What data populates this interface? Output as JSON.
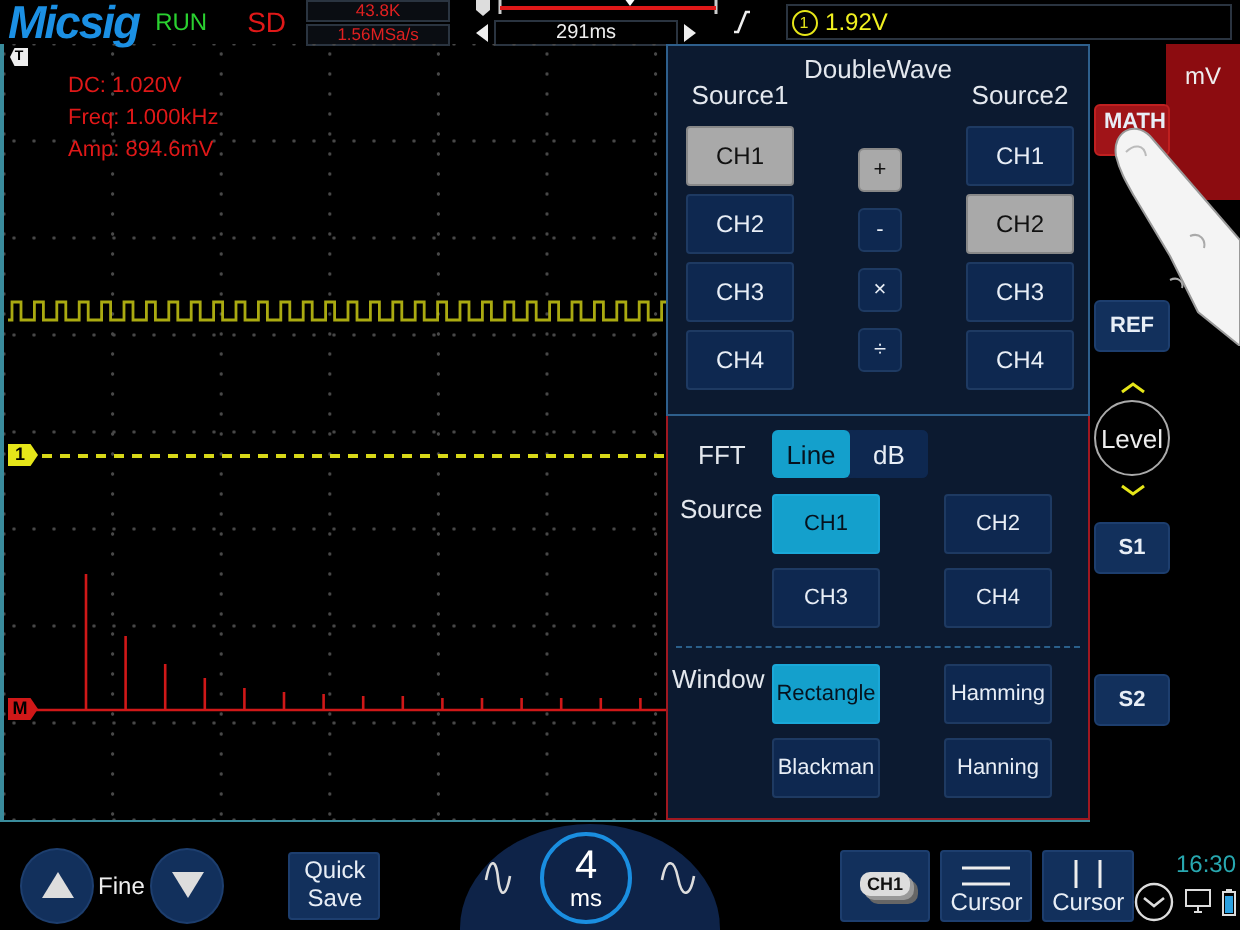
{
  "top_bar": {
    "logo": "Micsig",
    "run_state": "RUN",
    "mode": "SD",
    "memory_depth": "43.8K",
    "sample_rate": "1.56MSa/s",
    "time_offset": "291ms",
    "trigger_source": "1",
    "trigger_level": "1.92V"
  },
  "screen": {
    "trigger_marker": "T",
    "measurements": [
      "DC: 1.020V",
      "Freq: 1.000kHz",
      "Amp: 894.6mV"
    ],
    "markers": [
      {
        "label": "1",
        "kind": "channel",
        "color": "#e6e619"
      },
      {
        "label": "M",
        "kind": "math",
        "color": "#d01818"
      }
    ]
  },
  "math_panel": {
    "title": "DoubleWave",
    "source1": {
      "label": "Source1",
      "options": [
        {
          "label": "CH1",
          "selected": true
        },
        {
          "label": "CH2",
          "selected": false
        },
        {
          "label": "CH3",
          "selected": false
        },
        {
          "label": "CH4",
          "selected": false
        }
      ]
    },
    "operators": [
      {
        "label": "+",
        "selected": true
      },
      {
        "label": "-",
        "selected": false
      },
      {
        "label": "×",
        "selected": false
      },
      {
        "label": "÷",
        "selected": false
      }
    ],
    "source2": {
      "label": "Source2",
      "options": [
        {
          "label": "CH1",
          "selected": false
        },
        {
          "label": "CH2",
          "selected": true
        },
        {
          "label": "CH3",
          "selected": false
        },
        {
          "label": "CH4",
          "selected": false
        }
      ]
    },
    "fft": {
      "label": "FFT",
      "modes": [
        {
          "label": "Line",
          "selected": true
        },
        {
          "label": "dB",
          "selected": false
        }
      ],
      "source_label": "Source",
      "sources": [
        {
          "label": "CH1",
          "selected": true
        },
        {
          "label": "CH2",
          "selected": false
        },
        {
          "label": "CH3",
          "selected": false
        },
        {
          "label": "CH4",
          "selected": false
        }
      ],
      "window_label": "Window",
      "windows": [
        {
          "label": "Rectangle",
          "selected": true
        },
        {
          "label": "Hamming",
          "selected": false
        },
        {
          "label": "Blackman",
          "selected": false
        },
        {
          "label": "Hanning",
          "selected": false
        }
      ]
    }
  },
  "side": {
    "unit": "mV",
    "buttons": [
      {
        "label": "MATH",
        "kind": "math"
      },
      {
        "label": "REF",
        "kind": "button"
      },
      {
        "label": "Level",
        "kind": "level"
      },
      {
        "label": "S1",
        "kind": "button"
      },
      {
        "label": "S2",
        "kind": "button"
      }
    ]
  },
  "bottom_bar": {
    "fine_label": "Fine",
    "quick_save": "Quick Save",
    "timebase_value": "4",
    "timebase_unit": "ms",
    "channel": "CH1",
    "cursors": [
      {
        "label": "Cursor",
        "kind": "horizontal"
      },
      {
        "label": "Cursor",
        "kind": "vertical"
      }
    ],
    "clock": "16:30"
  }
}
